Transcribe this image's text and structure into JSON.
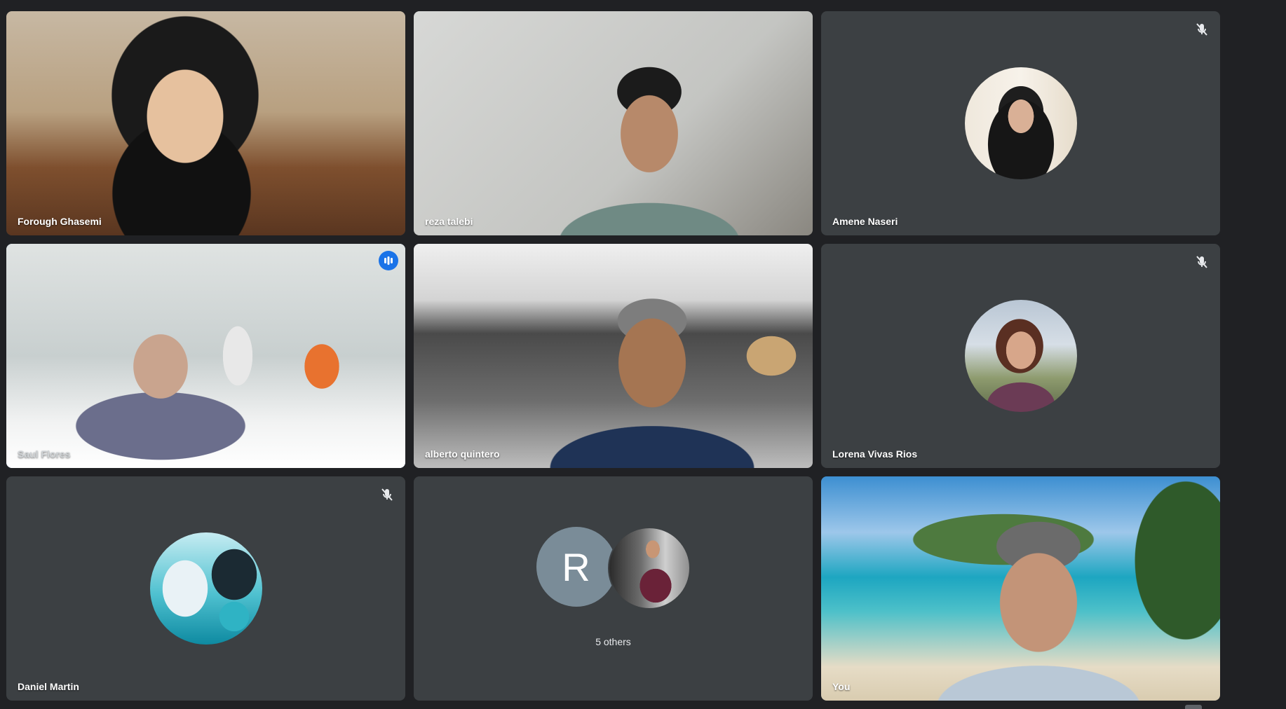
{
  "meeting": {
    "participants": [
      {
        "name": "Forough Ghasemi",
        "muted": false,
        "speaking": false
      },
      {
        "name": "reza talebi",
        "muted": false,
        "speaking": false
      },
      {
        "name": "Amene Naseri",
        "muted": true,
        "speaking": false
      },
      {
        "name": "Saul Flores",
        "muted": false,
        "speaking": true
      },
      {
        "name": "alberto quintero",
        "muted": false,
        "speaking": false
      },
      {
        "name": "Lorena Vivas Rios",
        "muted": true,
        "speaking": false
      },
      {
        "name": "Daniel Martin",
        "muted": true,
        "speaking": false
      },
      {
        "name": "5 others",
        "initial": "R",
        "muted": false,
        "speaking": false
      },
      {
        "name": "You",
        "muted": false,
        "speaking": false
      }
    ]
  },
  "colors": {
    "background": "#202124",
    "tile": "#3c4043",
    "speaking_border": "#8ab4f8",
    "speaking_badge": "#1a73e8",
    "initial_avatar": "#7a8c98"
  },
  "icons": {
    "mic_off": "mic-off-icon",
    "speaking": "audio-wave-icon"
  }
}
